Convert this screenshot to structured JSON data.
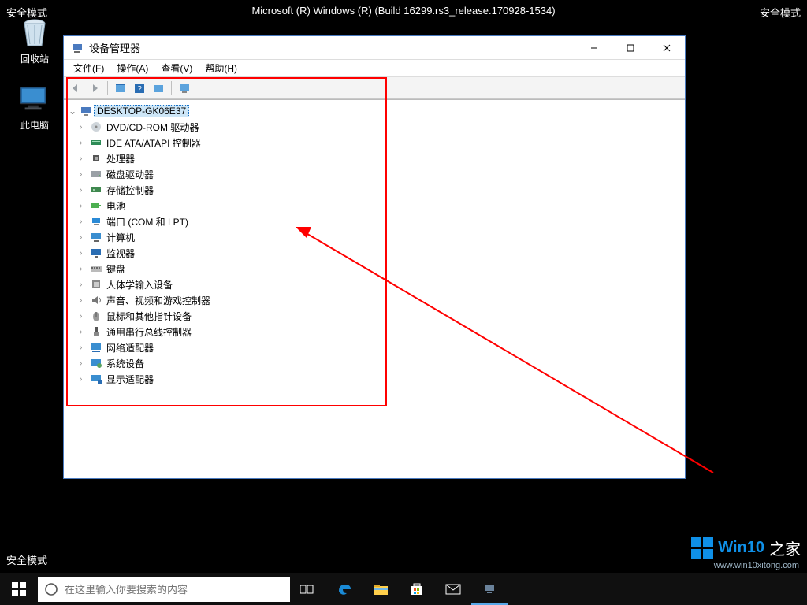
{
  "desktop": {
    "safe_mode_label": "安全模式",
    "build_string": "Microsoft (R) Windows (R) (Build 16299.rs3_release.170928-1534)",
    "icons": {
      "recycle": "回收站",
      "thispc": "此电脑"
    }
  },
  "window": {
    "title": "设备管理器",
    "menu": {
      "file": "文件(F)",
      "action": "操作(A)",
      "view": "查看(V)",
      "help": "帮助(H)"
    },
    "root_node": "DESKTOP-GK06E37",
    "nodes": [
      {
        "icon": "dvd-icon",
        "label": "DVD/CD-ROM 驱动器"
      },
      {
        "icon": "ide-icon",
        "label": "IDE ATA/ATAPI 控制器"
      },
      {
        "icon": "cpu-icon",
        "label": "处理器"
      },
      {
        "icon": "disk-icon",
        "label": "磁盘驱动器"
      },
      {
        "icon": "storage-icon",
        "label": "存储控制器"
      },
      {
        "icon": "battery-icon",
        "label": "电池"
      },
      {
        "icon": "port-icon",
        "label": "端口 (COM 和 LPT)"
      },
      {
        "icon": "computer-icon",
        "label": "计算机"
      },
      {
        "icon": "monitor-icon",
        "label": "监视器"
      },
      {
        "icon": "keyboard-icon",
        "label": "键盘"
      },
      {
        "icon": "hid-icon",
        "label": "人体学输入设备"
      },
      {
        "icon": "audio-icon",
        "label": "声音、视频和游戏控制器"
      },
      {
        "icon": "mouse-icon",
        "label": "鼠标和其他指针设备"
      },
      {
        "icon": "usb-icon",
        "label": "通用串行总线控制器"
      },
      {
        "icon": "network-icon",
        "label": "网络适配器"
      },
      {
        "icon": "system-icon",
        "label": "系统设备"
      },
      {
        "icon": "display-icon",
        "label": "显示适配器"
      }
    ]
  },
  "taskbar": {
    "search_placeholder": "在这里输入你要搜索的内容"
  },
  "watermark": {
    "brand1": "Win10",
    "brand2": "之家",
    "url": "www.win10xitong.com"
  }
}
